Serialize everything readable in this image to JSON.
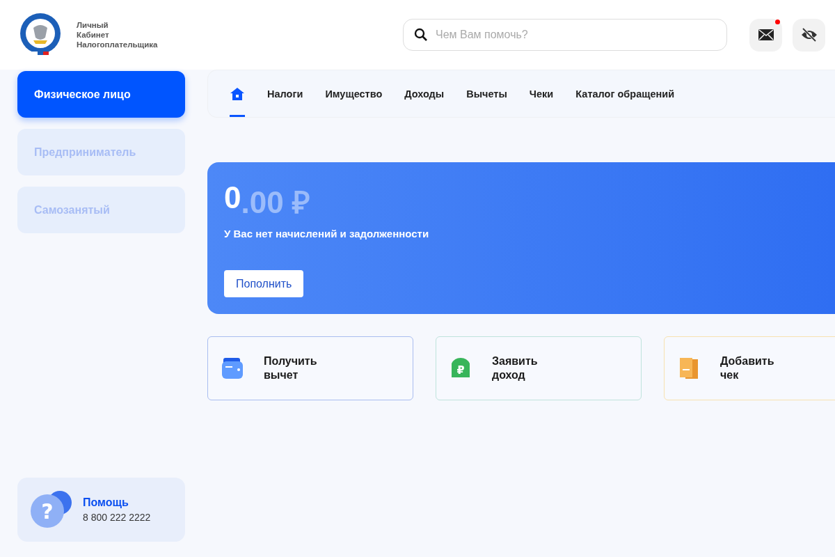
{
  "header": {
    "brand_lines": [
      "Личный",
      "Кабинет",
      "Налогоплательщика"
    ],
    "search": {
      "placeholder": "Чем Вам помочь?"
    },
    "mail": {
      "unread": true
    }
  },
  "sidebar": {
    "roles": [
      {
        "label": "Физическое лицо",
        "selected": true
      },
      {
        "label": "Предприниматель",
        "selected": false
      },
      {
        "label": "Самозанятый",
        "selected": false
      }
    ],
    "help": {
      "glyph": "?",
      "title": "Помощь",
      "phone": "8 800 222 2222"
    }
  },
  "nav": {
    "tabs": [
      {
        "kind": "home",
        "selected": true
      },
      {
        "kind": "text",
        "label": "Налоги",
        "selected": false
      },
      {
        "kind": "text",
        "label": "Имущество",
        "selected": false
      },
      {
        "kind": "text",
        "label": "Доходы",
        "selected": false
      },
      {
        "kind": "text",
        "label": "Вычеты",
        "selected": false
      },
      {
        "kind": "text",
        "label": "Чеки",
        "selected": false
      },
      {
        "kind": "text",
        "label": "Каталог обращений",
        "selected": false
      }
    ]
  },
  "balance": {
    "amount_whole": "0",
    "amount_rest": ".00 ₽",
    "message": "У Вас нет начислений и задолженности",
    "button": "Пополнить"
  },
  "actions": [
    {
      "kind": "wallet",
      "lines": [
        "Получить",
        "вычет"
      ],
      "color": "#a9bdf0"
    },
    {
      "kind": "ruble",
      "glyph": "₽",
      "lines": [
        "Заявить",
        "доход"
      ],
      "color": "#bfe3dc"
    },
    {
      "kind": "receipt",
      "lines": [
        "Добавить",
        "чек"
      ],
      "color": "#f7e2b0"
    }
  ]
}
